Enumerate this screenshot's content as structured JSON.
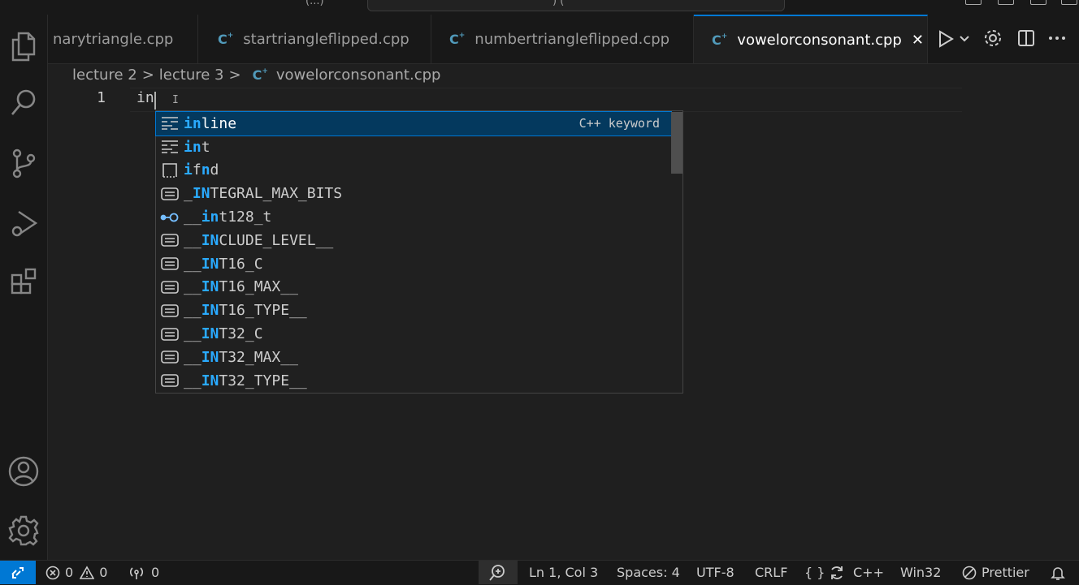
{
  "title_fragments": [
    "(...)",
    ") ("
  ],
  "tabs": [
    {
      "label": "narytriangle.cpp",
      "active": false
    },
    {
      "label": "startriangleflipped.cpp",
      "active": false
    },
    {
      "label": "numbertriangleflipped.cpp",
      "active": false
    },
    {
      "label": "vowelorconsonant.cpp",
      "active": true
    }
  ],
  "tab_close": "✕",
  "breadcrumb": {
    "items": [
      "lecture 2",
      "lecture 3",
      "vowelorconsonant.cpp"
    ],
    "separator": ">"
  },
  "editor": {
    "line_number": "1",
    "code": "in"
  },
  "suggest": {
    "detail": "C++ keyword",
    "items": [
      {
        "icon": "keyword-icon",
        "match": "in",
        "rest": "line",
        "pre": ""
      },
      {
        "icon": "keyword-icon",
        "match": "in",
        "rest": "t",
        "pre": ""
      },
      {
        "icon": "snippet-icon",
        "match": "i",
        "rest": "fnd",
        "pre": "",
        "mid_hl": "n"
      },
      {
        "icon": "text-icon",
        "pre": "_",
        "match": "IN",
        "rest": "TEGRAL_MAX_BITS"
      },
      {
        "icon": "typeparam-icon",
        "pre": "__",
        "match": "in",
        "rest": "t128_t"
      },
      {
        "icon": "text-icon",
        "pre": "__",
        "match": "IN",
        "rest": "CLUDE_LEVEL__"
      },
      {
        "icon": "text-icon",
        "pre": "__",
        "match": "IN",
        "rest": "T16_C"
      },
      {
        "icon": "text-icon",
        "pre": "__",
        "match": "IN",
        "rest": "T16_MAX__"
      },
      {
        "icon": "text-icon",
        "pre": "__",
        "match": "IN",
        "rest": "T16_TYPE__"
      },
      {
        "icon": "text-icon",
        "pre": "__",
        "match": "IN",
        "rest": "T32_C"
      },
      {
        "icon": "text-icon",
        "pre": "__",
        "match": "IN",
        "rest": "T32_MAX__"
      },
      {
        "icon": "text-icon",
        "pre": "__",
        "match": "IN",
        "rest": "T32_TYPE__"
      }
    ]
  },
  "status": {
    "errors": "0",
    "warnings": "0",
    "ports": "0",
    "position": "Ln 1, Col 3",
    "spaces": "Spaces: 4",
    "encoding": "UTF-8",
    "eol": "CRLF",
    "braces": "{ }",
    "language": "C++",
    "config": "Win32",
    "prettier": "Prettier"
  },
  "colors": {
    "accent": "#0078d4",
    "highlight": "#2aaaff",
    "background": "#1f1f1f"
  }
}
